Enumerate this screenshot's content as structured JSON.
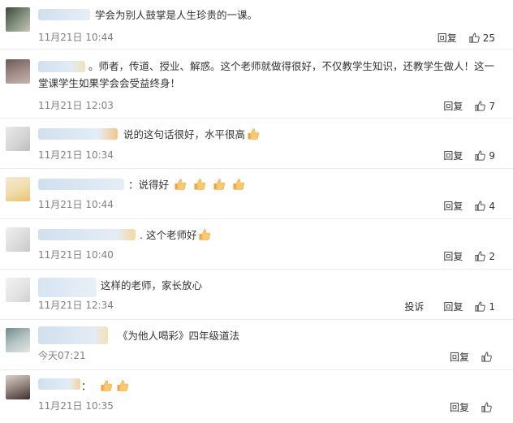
{
  "actions": {
    "reply": "回复",
    "report": "投诉"
  },
  "comments": [
    {
      "text": "学会为别人鼓掌是人生珍贵的一课。",
      "time": "11月21日 10:44",
      "likes": "25"
    },
    {
      "text": "。师者，传道、授业、解惑。这个老师就做得很好，不仅教学生知识，还教学生做人！这一堂课学生如果学会会受益终身！",
      "time": "11月21日 12:03",
      "likes": "7"
    },
    {
      "text": "说的这句话很好，水平很高",
      "time": "11月21日 10:34",
      "likes": "9"
    },
    {
      "text": "：说得好",
      "time": "11月21日 10:44",
      "likes": "4"
    },
    {
      "text": ". 这个老师好",
      "time": "11月21日 10:40",
      "likes": "2"
    },
    {
      "text": "这样的老师，家长放心",
      "time": "11月21日 12:34",
      "likes": "1"
    },
    {
      "text": "《为他人喝彩》四年级道法",
      "time": "今天07:21",
      "likes": ""
    },
    {
      "text": "：",
      "time": "11月21日 10:35",
      "likes": ""
    }
  ]
}
